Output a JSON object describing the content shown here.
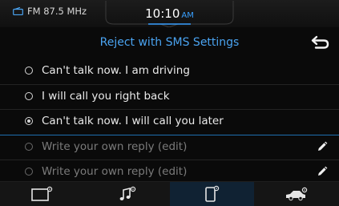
{
  "status_bar": {
    "source": "FM 87.5 MHz",
    "time": "10:10",
    "ampm": "AM"
  },
  "header": {
    "title": "Reject with SMS Settings"
  },
  "messages": [
    {
      "label": "Can't talk now. I am driving",
      "selected": false,
      "editable": false
    },
    {
      "label": "I will call you right back",
      "selected": false,
      "editable": false
    },
    {
      "label": "Can't talk now. I will call you later",
      "selected": true,
      "editable": false
    },
    {
      "label": "Write your own reply (edit)",
      "selected": false,
      "editable": true
    },
    {
      "label": "Write your own reply (edit)",
      "selected": false,
      "editable": true
    }
  ],
  "bottom_tabs": [
    {
      "icon": "display-settings-icon",
      "active": false
    },
    {
      "icon": "music-settings-icon",
      "active": false
    },
    {
      "icon": "phone-settings-icon",
      "active": true
    },
    {
      "icon": "car-settings-icon",
      "active": false
    }
  ],
  "colors": {
    "accent": "#4aa3f0",
    "ampm": "#39a0ff",
    "active_tab": "#102233"
  }
}
